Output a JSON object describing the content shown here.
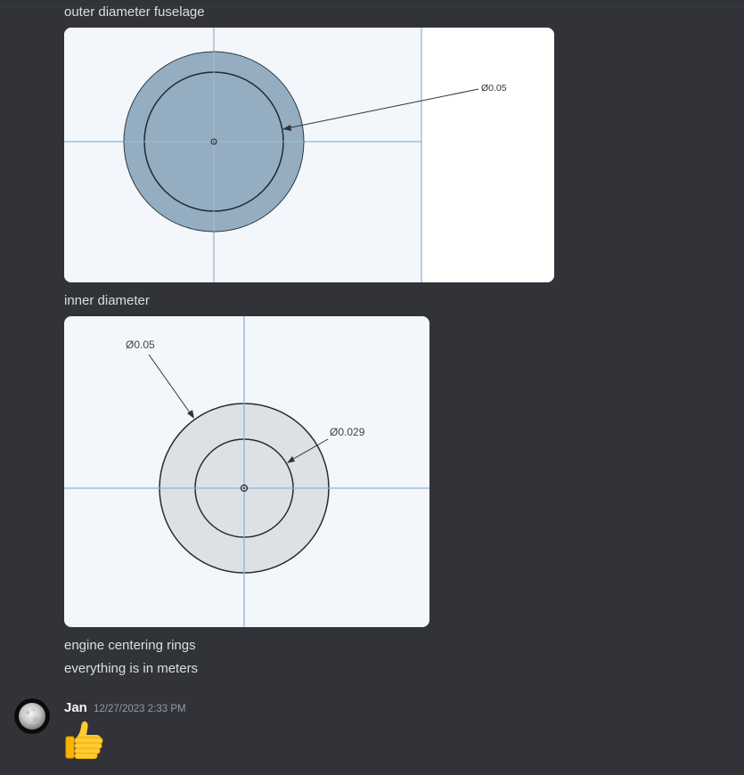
{
  "messages": {
    "outer_caption": "outer diameter fuselage",
    "inner_caption": "inner diameter",
    "rings_caption": "engine centering rings",
    "units_note": "everything is in meters"
  },
  "drawing_outer": {
    "dimension_label": "Ø0.05",
    "fill_color": "#8ea9bd",
    "background_color": "#f3f6fa",
    "axis_color": "#8fb2d6"
  },
  "drawing_inner": {
    "outer_dimension_label": "Ø0.05",
    "inner_dimension_label": "Ø0.029",
    "fill_color": "#dde1e6",
    "background_color": "#f3f6fa",
    "axis_color": "#8fb2d6"
  },
  "reply": {
    "author": "Jan",
    "timestamp": "12/27/2023 2:33 PM",
    "emoji_icon": "thumbs-up-icon"
  },
  "theme": {
    "background": "#313338",
    "text": "#dbdee1",
    "muted": "#949ba4"
  }
}
